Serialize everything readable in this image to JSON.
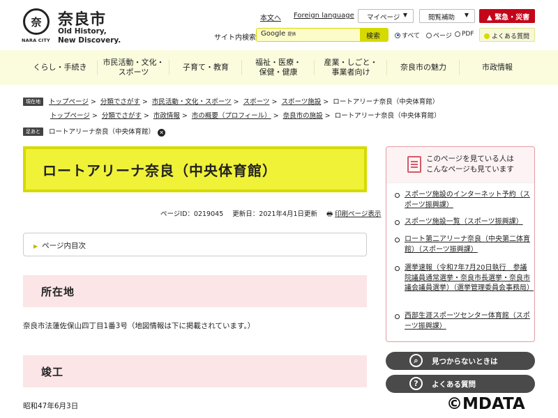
{
  "header": {
    "city_name": "奈良市",
    "seal_char": "奈",
    "seal_caption": "NARA CITY",
    "tagline_1": "Old History,",
    "tagline_2": "New Discovery.",
    "links": {
      "text_version": "本文へ",
      "foreign": "Foreign language"
    },
    "my_page": "マイページ",
    "browse_help": "閲覧補助",
    "emergency": "緊急・災害",
    "search_label": "サイト内検索",
    "search_brand": "Google",
    "search_brand_sub": "提供",
    "search_button": "検索",
    "search_scope": [
      "すべて",
      "ページ",
      "PDF"
    ],
    "faq": "よくある質問"
  },
  "nav": [
    "くらし・手続き",
    "市民活動・文化・\nスポーツ",
    "子育て・教育",
    "福祉・医療・\n保健・健康",
    "産業・しごと・\n事業者向け",
    "奈良市の魅力",
    "市政情報"
  ],
  "breadcrumbs": {
    "current_tag": "現在地",
    "trail1": [
      "トップページ",
      "分類でさがす",
      "市民活動・文化・スポーツ",
      "スポーツ",
      "スポーツ施設"
    ],
    "trail2": [
      "トップページ",
      "分類でさがす",
      "市政情報",
      "市の概要（プロフィール）",
      "奈良市の施設"
    ],
    "current": "ロートアリーナ奈良（中央体育館）",
    "footprint_tag": "足あと",
    "footprint_item": "ロートアリーナ奈良（中央体育館）"
  },
  "page": {
    "title": "ロートアリーナ奈良（中央体育館）",
    "page_id": "ページID：0219045",
    "updated": "更新日：2021年4月1日更新",
    "print": "印刷ページ表示",
    "toc": "ページ内目次",
    "sections": [
      {
        "heading": "所在地",
        "text": "奈良市法蓮佐保山四丁目1番3号（地図情報は下に掲載されています。）"
      },
      {
        "heading": "竣工",
        "text": "昭和47年6月3日"
      }
    ]
  },
  "sidebar": {
    "title": "このページを見ている人は\nこんなページも見ています",
    "items": [
      "スポーツ施設のインターネット予約（スポーツ振興課）",
      "スポーツ施設一覧（スポーツ振興課）",
      "ロート第二アリーナ奈良（中央第二体育館）（スポーツ振興課）",
      "選挙速報（令和7年7月20日執行　参議院議員通常選挙・奈良市長選挙・奈良市議会議員選挙）（選挙管理委員会事務局）",
      "西部生涯スポーツセンター体育館（スポーツ振興課）"
    ],
    "not_found": "見つからないときは",
    "faq": "よくある質問"
  },
  "watermark": "©MDATA",
  "colors": {
    "accent": "#d6da00",
    "accent_light": "#f0f238",
    "section_bg": "#fbe5e7",
    "emergency": "#c4061a",
    "sidebar_border": "#e49aa2"
  }
}
